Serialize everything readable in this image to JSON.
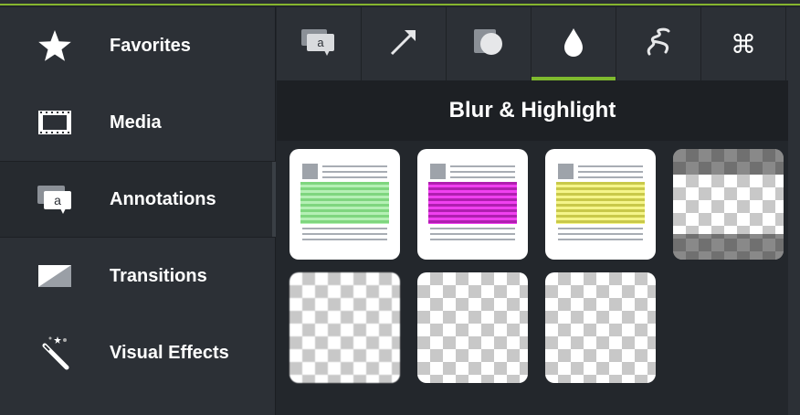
{
  "sidebar": {
    "items": [
      {
        "label": "Favorites",
        "icon": "star-icon"
      },
      {
        "label": "Media",
        "icon": "film-strip-icon"
      },
      {
        "label": "Annotations",
        "icon": "callout-icon",
        "active": true
      },
      {
        "label": "Transitions",
        "icon": "transition-icon"
      },
      {
        "label": "Visual Effects",
        "icon": "magic-wand-icon"
      }
    ]
  },
  "tabs": [
    {
      "icon": "callout-tab-icon"
    },
    {
      "icon": "arrow-icon"
    },
    {
      "icon": "shape-icon"
    },
    {
      "icon": "blur-drop-icon",
      "active": true
    },
    {
      "icon": "sketch-motion-icon"
    },
    {
      "icon": "keystroke-icon",
      "glyph": "⌘"
    }
  ],
  "section": {
    "title": "Blur & Highlight"
  },
  "tiles": [
    {
      "name": "highlight-green",
      "color": "#8be38b"
    },
    {
      "name": "highlight-magenta",
      "color": "#e83be8"
    },
    {
      "name": "highlight-yellow",
      "color": "#f2f27a"
    },
    {
      "name": "blur-spotlight"
    },
    {
      "name": "blur-full"
    },
    {
      "name": "pixelate"
    },
    {
      "name": "interactive-hotspot"
    }
  ],
  "colors": {
    "accent": "#7fba2e"
  }
}
